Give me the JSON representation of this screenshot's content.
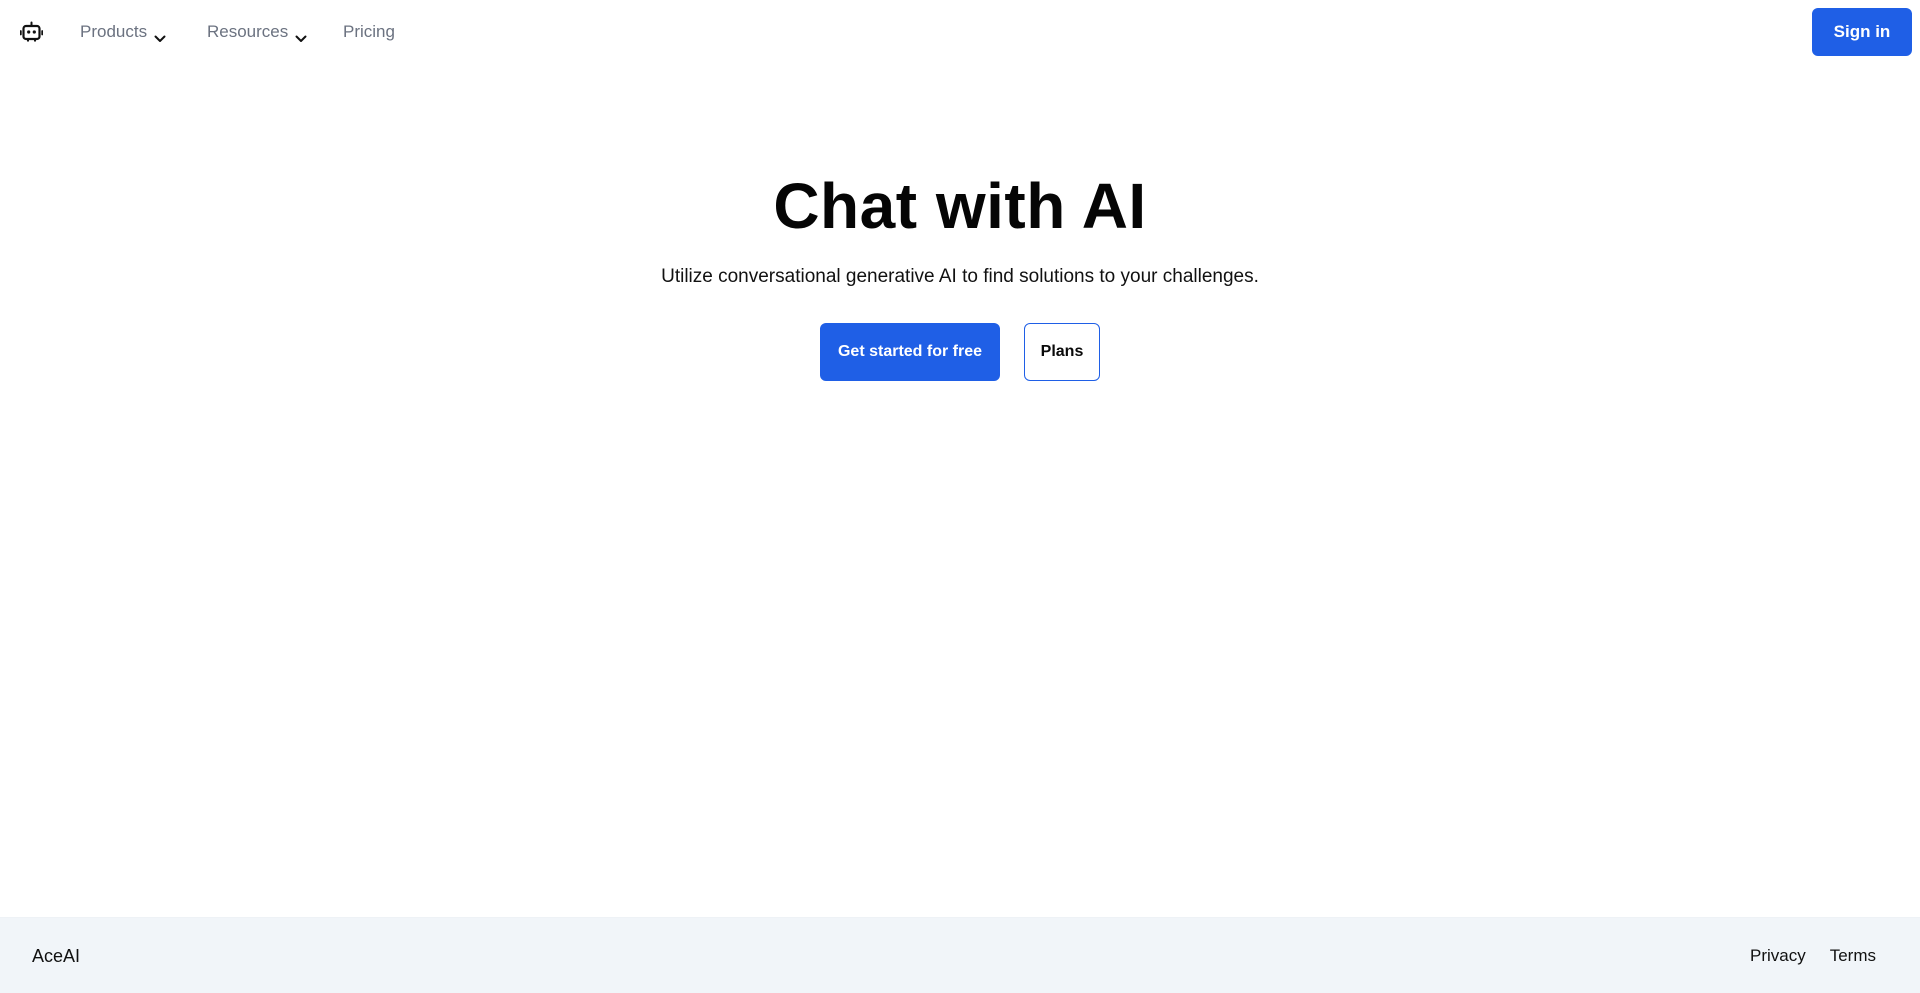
{
  "header": {
    "logo_icon": "robot-icon",
    "nav": {
      "products": "Products",
      "resources": "Resources",
      "pricing": "Pricing"
    },
    "dropdown_icon": "chevron-down-icon",
    "signin_label": "Sign in"
  },
  "hero": {
    "title": "Chat with AI",
    "subtitle": "Utilize conversational generative AI to find solutions to your challenges.",
    "primary_cta": "Get started for free",
    "secondary_cta": "Plans"
  },
  "footer": {
    "brand": "AceAI",
    "links": {
      "privacy": "Privacy",
      "terms": "Terms"
    }
  },
  "colors": {
    "accent": "#1f5fe6",
    "footer_bg": "#f1f5f9",
    "nav_text": "#6b7280"
  }
}
